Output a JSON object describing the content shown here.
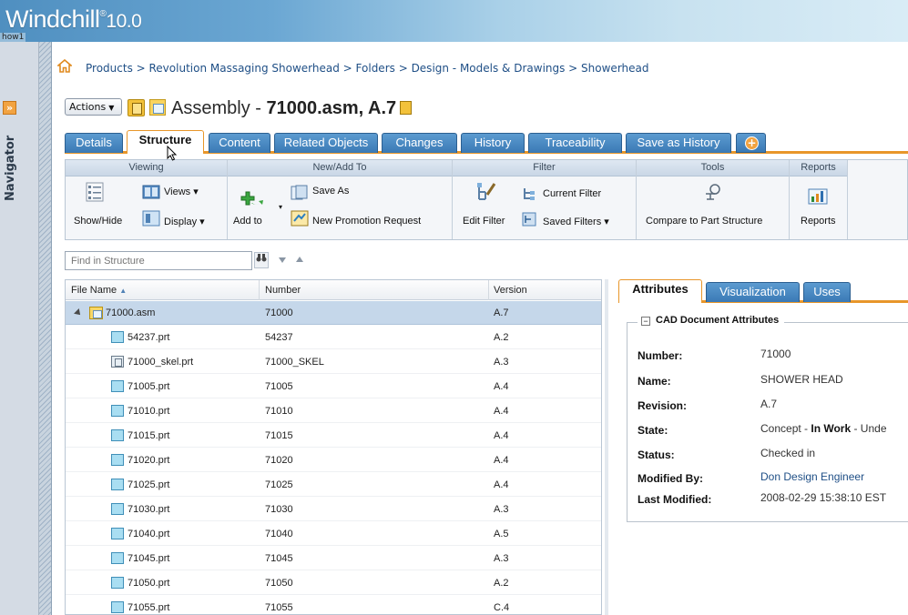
{
  "header": {
    "app_name": "Windchill",
    "trademark": "®",
    "version": "10.0",
    "user": "how1"
  },
  "navigator": {
    "label": "Navigator",
    "expand_glyph": "»"
  },
  "breadcrumb": {
    "path": "Products > Revolution Massaging Showerhead > Folders > Design - Models & Drawings > Showerhead"
  },
  "title_bar": {
    "actions_label": "Actions",
    "object_type": "Assembly - ",
    "object_name": "71000.asm, A.7"
  },
  "tabs": [
    {
      "label": "Details"
    },
    {
      "label": "Structure",
      "active": true
    },
    {
      "label": "Content"
    },
    {
      "label": "Related Objects"
    },
    {
      "label": "Changes"
    },
    {
      "label": "History"
    },
    {
      "label": "Traceability"
    },
    {
      "label": "Save as History"
    }
  ],
  "toolbar": {
    "viewing": {
      "title": "Viewing",
      "show_hide": "Show/Hide",
      "views": "Views",
      "display": "Display"
    },
    "new_add": {
      "title": "New/Add To",
      "add_to": "Add to",
      "save_as": "Save As",
      "new_promotion": "New Promotion Request"
    },
    "filter": {
      "title": "Filter",
      "edit_filter": "Edit Filter",
      "current_filter": "Current Filter",
      "saved_filters": "Saved Filters"
    },
    "tools": {
      "title": "Tools",
      "compare": "Compare to Part Structure"
    },
    "reports": {
      "title": "Reports",
      "reports": "Reports"
    }
  },
  "find": {
    "placeholder": "Find in Structure"
  },
  "tree": {
    "columns": [
      "File Name",
      "Number",
      "Version"
    ],
    "sort_indicator": "▲",
    "rows": [
      {
        "name": "71000.asm",
        "number": "71000",
        "version": "A.7",
        "type": "asm"
      },
      {
        "name": "54237.prt",
        "number": "54237",
        "version": "A.2",
        "type": "prt"
      },
      {
        "name": "71000_skel.prt",
        "number": "71000_SKEL",
        "version": "A.3",
        "type": "skel"
      },
      {
        "name": "71005.prt",
        "number": "71005",
        "version": "A.4",
        "type": "prt"
      },
      {
        "name": "71010.prt",
        "number": "71010",
        "version": "A.4",
        "type": "prt"
      },
      {
        "name": "71015.prt",
        "number": "71015",
        "version": "A.4",
        "type": "prt"
      },
      {
        "name": "71020.prt",
        "number": "71020",
        "version": "A.4",
        "type": "prt"
      },
      {
        "name": "71025.prt",
        "number": "71025",
        "version": "A.4",
        "type": "prt"
      },
      {
        "name": "71030.prt",
        "number": "71030",
        "version": "A.3",
        "type": "prt"
      },
      {
        "name": "71040.prt",
        "number": "71040",
        "version": "A.5",
        "type": "prt"
      },
      {
        "name": "71045.prt",
        "number": "71045",
        "version": "A.3",
        "type": "prt"
      },
      {
        "name": "71050.prt",
        "number": "71050",
        "version": "A.2",
        "type": "prt"
      },
      {
        "name": "71055.prt",
        "number": "71055",
        "version": "C.4",
        "type": "prt"
      }
    ]
  },
  "right_panel": {
    "tabs": [
      {
        "label": "Attributes",
        "active": true
      },
      {
        "label": "Visualization"
      },
      {
        "label": "Uses"
      }
    ],
    "section_title": "CAD Document Attributes",
    "attributes": {
      "number_label": "Number:",
      "number_value": "71000",
      "name_label": "Name:",
      "name_value": "SHOWER HEAD",
      "revision_label": "Revision:",
      "revision_value": "A.7",
      "state_label": "State:",
      "state_prefix": "Concept - ",
      "state_bold": "In Work",
      "state_suffix": " - Unde",
      "status_label": "Status:",
      "status_value": "Checked in",
      "modified_by_label": "Modified By:",
      "modified_by_value": "Don Design Engineer",
      "last_modified_label": "Last Modified:",
      "last_modified_value": "2008-02-29 15:38:10 EST"
    }
  },
  "colors": {
    "accent_orange": "#e8962a",
    "tab_blue": "#3a79b5",
    "link_blue": "#1f4f86",
    "selected_row": "#c5d7ea"
  }
}
